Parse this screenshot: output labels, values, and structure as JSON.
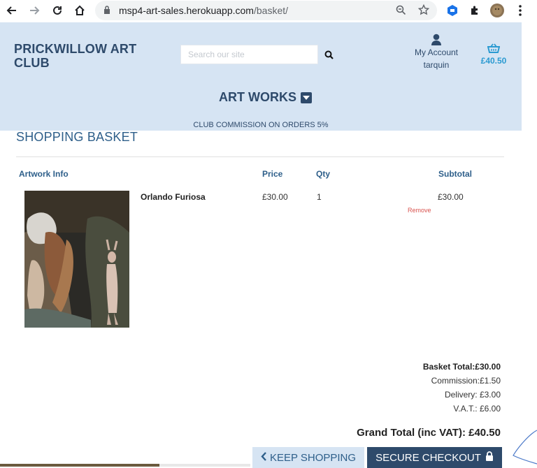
{
  "browser": {
    "url_host": "msp4-art-sales.herokuapp.com",
    "url_path": "/basket/"
  },
  "header": {
    "brand_line1": "PRICKWILLOW ART",
    "brand_line2": "CLUB",
    "search_placeholder": "Search our site",
    "account_label": "My Account",
    "account_user": "tarquin",
    "basket_total": "£40.50",
    "nav_artworks": "ART WORKS",
    "commission_note": "CLUB COMMISSION ON ORDERS 5%"
  },
  "basket": {
    "title": "SHOPPING BASKET",
    "columns": {
      "info": "Artwork Info",
      "price": "Price",
      "qty": "Qty",
      "subtotal": "Subtotal"
    },
    "items": [
      {
        "name": "Orlando Furiosa",
        "price": "£30.00",
        "qty": "1",
        "subtotal": "£30.00",
        "remove_label": "Remove"
      }
    ],
    "summary": {
      "basket_total": "Basket Total:£30.00",
      "commission": "Commission:£1.50",
      "delivery": "Delivery: £3.00",
      "vat": "V.A.T.: £6.00",
      "grand_total": "Grand Total (inc VAT): £40.50"
    },
    "buttons": {
      "keep_shopping": "KEEP SHOPPING",
      "secure_checkout": "SECURE CHECKOUT"
    }
  },
  "colors": {
    "header_bg": "#d6e4f3",
    "brand": "#2e4a6b",
    "accent_blue": "#2b9ad1",
    "remove_red": "#d9534f"
  },
  "icons": [
    "back-arrow-icon",
    "forward-arrow-icon",
    "reload-icon",
    "home-icon",
    "lock-icon",
    "zoom-icon",
    "star-icon",
    "extension-icon",
    "puzzle-icon",
    "profile-avatar",
    "kebab-menu-icon",
    "search-icon",
    "user-icon",
    "basket-icon",
    "caret-down-icon",
    "chevron-left-icon",
    "padlock-icon"
  ]
}
